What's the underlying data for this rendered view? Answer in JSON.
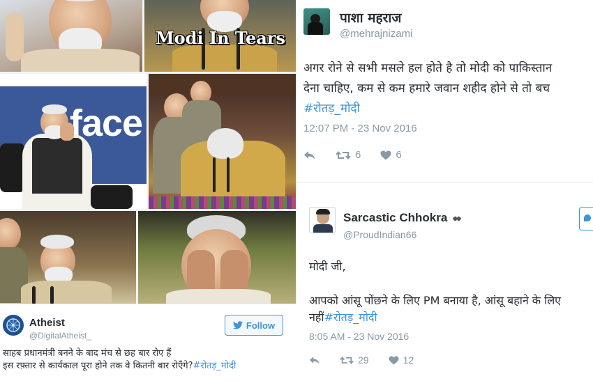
{
  "collage": {
    "tears_caption": "Modi In Tears",
    "facebook_backdrop_text": "face"
  },
  "tweets": {
    "pasha": {
      "name": "पाशा महराज",
      "handle": "@mehrajnizami",
      "text_line1": "अगर रोने से सभी मसले हल होते है तो मोदी को पाकिस्तान",
      "text_line2": "देना चाहिए, कम से कम हमारे जवान शहीद होने से तो बच",
      "hashtag": "#रोतड़_मोदी",
      "timestamp": "12:07 PM - 23 Nov 2016",
      "retweets": "6",
      "likes": "6"
    },
    "sarcastic": {
      "name": "Sarcastic Chhokra",
      "handle": "@ProudIndian66",
      "line1": "मोदी जी,",
      "line2": "आपको आंसू पोंछने के लिए PM बनाया है, आंसू बहाने के लिए",
      "line3_prefix": "नहीं",
      "hashtag": "#रोतड़_मोदी",
      "timestamp": "8:05 AM - 23 Nov 2016",
      "retweets": "29",
      "likes": "12"
    },
    "atheist": {
      "name": "Atheist",
      "handle": "@DigitalAtheist_",
      "follow_label": "Follow",
      "text_line1": "साहब प्रधानमंत्री बनने के बाद मंच से छह बार रोए हैं",
      "text_line2": "इस रफ़्तार से कार्यकाल पूरा होने तक वे कितनी बार रोएँगे?",
      "hashtag": "#रोतड़_मोदी"
    }
  },
  "colors": {
    "twitter_blue": "#3b94d9",
    "muted_text": "#8899a6",
    "facebook_blue": "#3b5998"
  },
  "icons": [
    "reply-icon",
    "retweet-icon",
    "heart-icon",
    "twitter-bird-icon",
    "verified-badge-icon"
  ]
}
